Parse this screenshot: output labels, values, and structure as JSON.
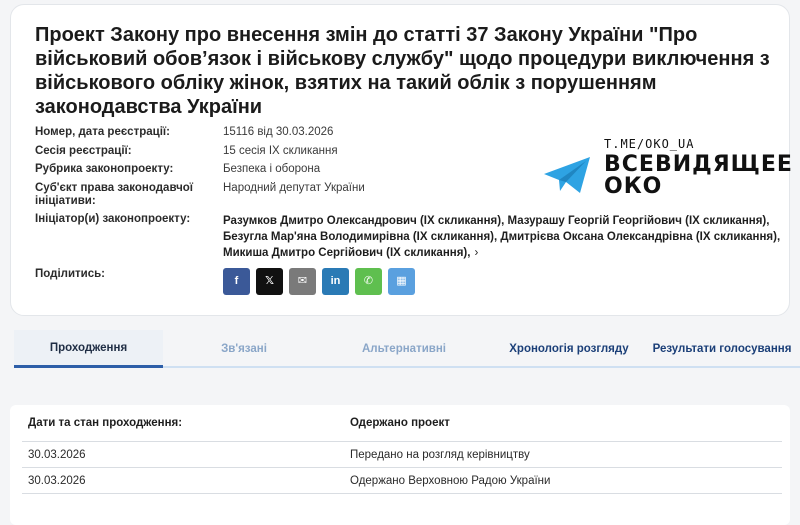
{
  "bill": {
    "title": "Проект Закону про внесення змін до статті 37 Закону України \"Про військовий обов’язок і військову службу\" щодо процедури виключення з військового обліку жінок, взятих на такий облік з порушенням законодавства України",
    "fields": [
      {
        "label": "Номер, дата реєстрації:",
        "value": "15116 від 30.03.2026"
      },
      {
        "label": "Сесія реєстрації:",
        "value": "15 сесія IX скликання"
      },
      {
        "label": "Рубрика законопроекту:",
        "value": "Безпека і оборона"
      },
      {
        "label": "Суб'єкт права законодавчої ініціативи:",
        "value": "Народний депутат України"
      },
      {
        "label": "Ініціатор(и) законопроекту:",
        "value": "Разумков Дмитро Олександрович (IX скликання), Мазурашу Георгій Георгійович (IX скликання), Безугла Мар'яна Володимирівна (IX скликання), Дмитрієва Оксана Олександрівна (IX скликання), Микиша Дмитро Сергійович (IX скликання),"
      },
      {
        "label": "Поділитись:",
        "value": ""
      }
    ],
    "more_chevron": "›"
  },
  "share": [
    {
      "name": "facebook",
      "glyph": "f",
      "color": "#3b5998"
    },
    {
      "name": "x",
      "glyph": "𝕏",
      "color": "#111111"
    },
    {
      "name": "email",
      "glyph": "✉",
      "color": "#7a7a7a"
    },
    {
      "name": "linkedin",
      "glyph": "in",
      "color": "#2a7ab5"
    },
    {
      "name": "whatsapp",
      "glyph": "✆",
      "color": "#5fbf4f"
    },
    {
      "name": "qr",
      "glyph": "▦",
      "color": "#5aa0df"
    }
  ],
  "watermark": {
    "url": "T.ME/OKO_UA",
    "line1": "ВСЕВИДЯЩЕЕ",
    "line2": "ОКО",
    "color": "#2ea3e3"
  },
  "tabs": [
    {
      "label": "Проходження",
      "active": true
    },
    {
      "label": "Зв'язані",
      "active": false
    },
    {
      "label": "Альтернативні",
      "active": false
    },
    {
      "label": "Хронологія розгляду",
      "active": false
    },
    {
      "label": "Результати голосування",
      "active": false
    }
  ],
  "progress": {
    "header": [
      "Дати та стан проходження:",
      "Одержано проект"
    ],
    "rows": [
      [
        "30.03.2026",
        "Передано на розгляд керівництву"
      ],
      [
        "30.03.2026",
        "Одержано Верховною Радою України"
      ]
    ]
  },
  "colors": {
    "accent": "#2d5ea8",
    "tab_inactive": "#8aa6c8"
  }
}
